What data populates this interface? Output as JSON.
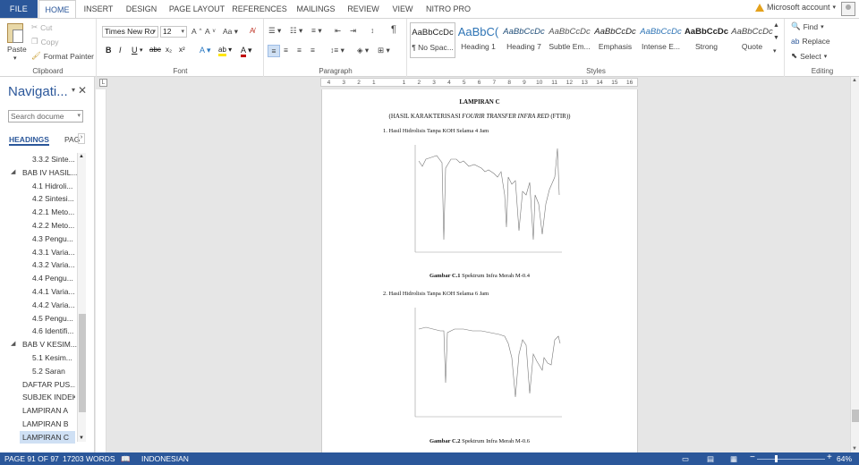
{
  "tabs": [
    {
      "label": "FILE"
    },
    {
      "label": "HOME"
    },
    {
      "label": "INSERT"
    },
    {
      "label": "DESIGN"
    },
    {
      "label": "PAGE LAYOUT"
    },
    {
      "label": "REFERENCES"
    },
    {
      "label": "MAILINGS"
    },
    {
      "label": "REVIEW"
    },
    {
      "label": "VIEW"
    },
    {
      "label": "NITRO PRO"
    }
  ],
  "account": {
    "label": "Microsoft account"
  },
  "clipboard": {
    "paste": "Paste",
    "cut": "Cut",
    "copy": "Copy",
    "format_painter": "Format Painter",
    "label": "Clipboard"
  },
  "font": {
    "family": "Times New Ro",
    "size": "12",
    "label": "Font"
  },
  "paragraph": {
    "label": "Paragraph"
  },
  "styles": {
    "label": "Styles",
    "items": [
      {
        "preview": "AaBbCcDc",
        "name": "¶ No Spac..."
      },
      {
        "preview": "AaBbC(",
        "name": "Heading 1"
      },
      {
        "preview": "AaBbCcDc",
        "name": "Heading 7"
      },
      {
        "preview": "AaBbCcDc",
        "name": "Subtle Em..."
      },
      {
        "preview": "AaBbCcDc",
        "name": "Emphasis"
      },
      {
        "preview": "AaBbCcDc",
        "name": "Intense E..."
      },
      {
        "preview": "AaBbCcDc",
        "name": "Strong"
      },
      {
        "preview": "AaBbCcDc",
        "name": "Quote"
      }
    ]
  },
  "editing": {
    "find": "Find",
    "replace": "Replace",
    "select": "Select",
    "label": "Editing"
  },
  "nav": {
    "title": "Navigati...",
    "search_placeholder": "Search docume",
    "tab_headings": "HEADINGS",
    "tab_pages": "PAG",
    "items": [
      {
        "label": "3.3.2 Sinte...",
        "level": 2
      },
      {
        "label": "BAB IV HASIL...",
        "level": 1
      },
      {
        "label": "4.1 Hidroli...",
        "level": 2
      },
      {
        "label": "4.2 Sintesi...",
        "level": 2
      },
      {
        "label": "4.2.1 Meto...",
        "level": 2
      },
      {
        "label": "4.2.2 Meto...",
        "level": 2
      },
      {
        "label": "4.3 Pengu...",
        "level": 2
      },
      {
        "label": "4.3.1 Varia...",
        "level": 2
      },
      {
        "label": "4.3.2 Varia...",
        "level": 2
      },
      {
        "label": "4.4 Pengu...",
        "level": 2
      },
      {
        "label": "4.4.1 Varia...",
        "level": 2
      },
      {
        "label": "4.4.2 Varia...",
        "level": 2
      },
      {
        "label": "4.5 Pengu...",
        "level": 2
      },
      {
        "label": "4.6 Identifi...",
        "level": 2
      },
      {
        "label": "BAB V KESIM...",
        "level": 1
      },
      {
        "label": "5.1 Kesim...",
        "level": 2
      },
      {
        "label": "5.2 Saran",
        "level": 2
      },
      {
        "label": "DAFTAR PUS...",
        "level": 0
      },
      {
        "label": "SUBJEK INDEKS",
        "level": 0
      },
      {
        "label": "LAMPIRAN A",
        "level": 0
      },
      {
        "label": "LAMPIRAN B",
        "level": 0
      },
      {
        "label": "LAMPIRAN C",
        "level": 0
      }
    ]
  },
  "ruler": {
    "ticks": [
      "4",
      "3",
      "2",
      "1",
      "",
      "1",
      "2",
      "3",
      "4",
      "5",
      "6",
      "7",
      "8",
      "9",
      "10",
      "11",
      "12",
      "13",
      "14",
      "15",
      "16"
    ]
  },
  "document": {
    "heading": "LAMPIRAN C",
    "subtitle_pre": "(HASIL KARAKTERISASI ",
    "subtitle_italic": "FOURIR TRANSFER INFRA RED",
    "subtitle_post": " (FTIR))",
    "item1": "1.   Hasil Hidrolisis Tanpa KOH Selama 4 Jam",
    "caption1_bold": "Gambar C.1",
    "caption1_rest": " Spektrum Infra Merah M-0.4",
    "item2": "2.   Hasil Hidrolisis Tanpa KOH Selama 6 Jam",
    "caption2_bold": "Gambar C.2",
    "caption2_rest": " Spektrum Infra Merah M-0.6"
  },
  "status": {
    "page": "PAGE 91 OF 97",
    "words": "17203 WORDS",
    "language": "INDONESIAN",
    "zoom": "64%"
  },
  "colors": {
    "accent": "#2b579a",
    "nav_selected": "#cfe0f4"
  }
}
